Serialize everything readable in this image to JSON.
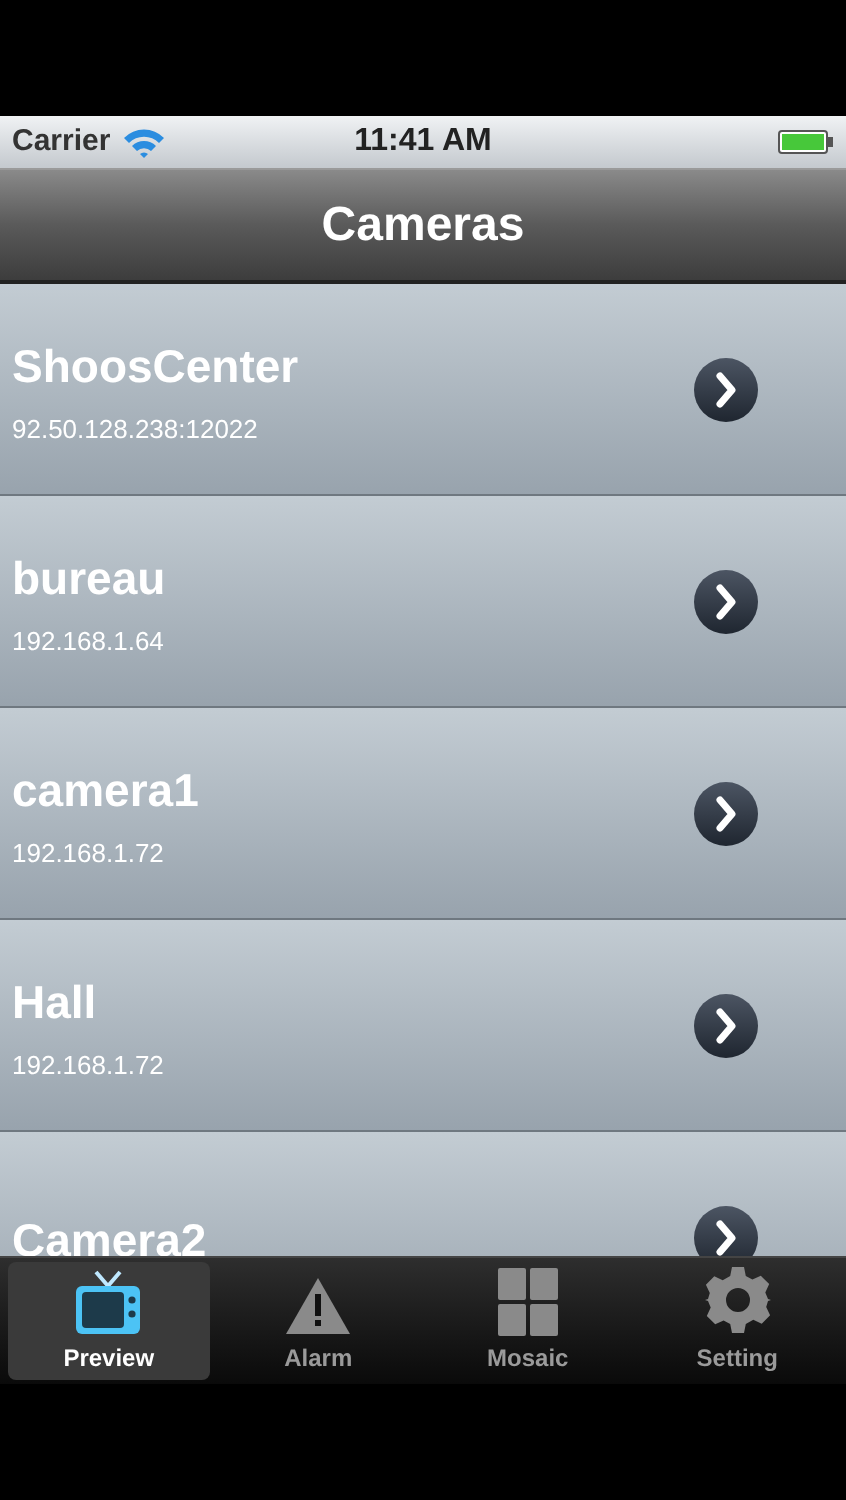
{
  "status_bar": {
    "carrier": "Carrier",
    "time": "11:41 AM"
  },
  "nav_bar": {
    "title": "Cameras"
  },
  "cameras": [
    {
      "name": "ShoosCenter",
      "address": "92.50.128.238:12022"
    },
    {
      "name": "bureau",
      "address": "192.168.1.64"
    },
    {
      "name": "camera1",
      "address": "192.168.1.72"
    },
    {
      "name": "Hall",
      "address": "192.168.1.72"
    },
    {
      "name": "Camera2"
    }
  ],
  "tab_bar": [
    {
      "label": "Preview",
      "kind": "tv",
      "selected": true
    },
    {
      "label": "Alarm",
      "kind": "warning",
      "selected": false
    },
    {
      "label": "Mosaic",
      "kind": "grid",
      "selected": false
    },
    {
      "label": "Setting",
      "kind": "gear",
      "selected": false
    }
  ]
}
